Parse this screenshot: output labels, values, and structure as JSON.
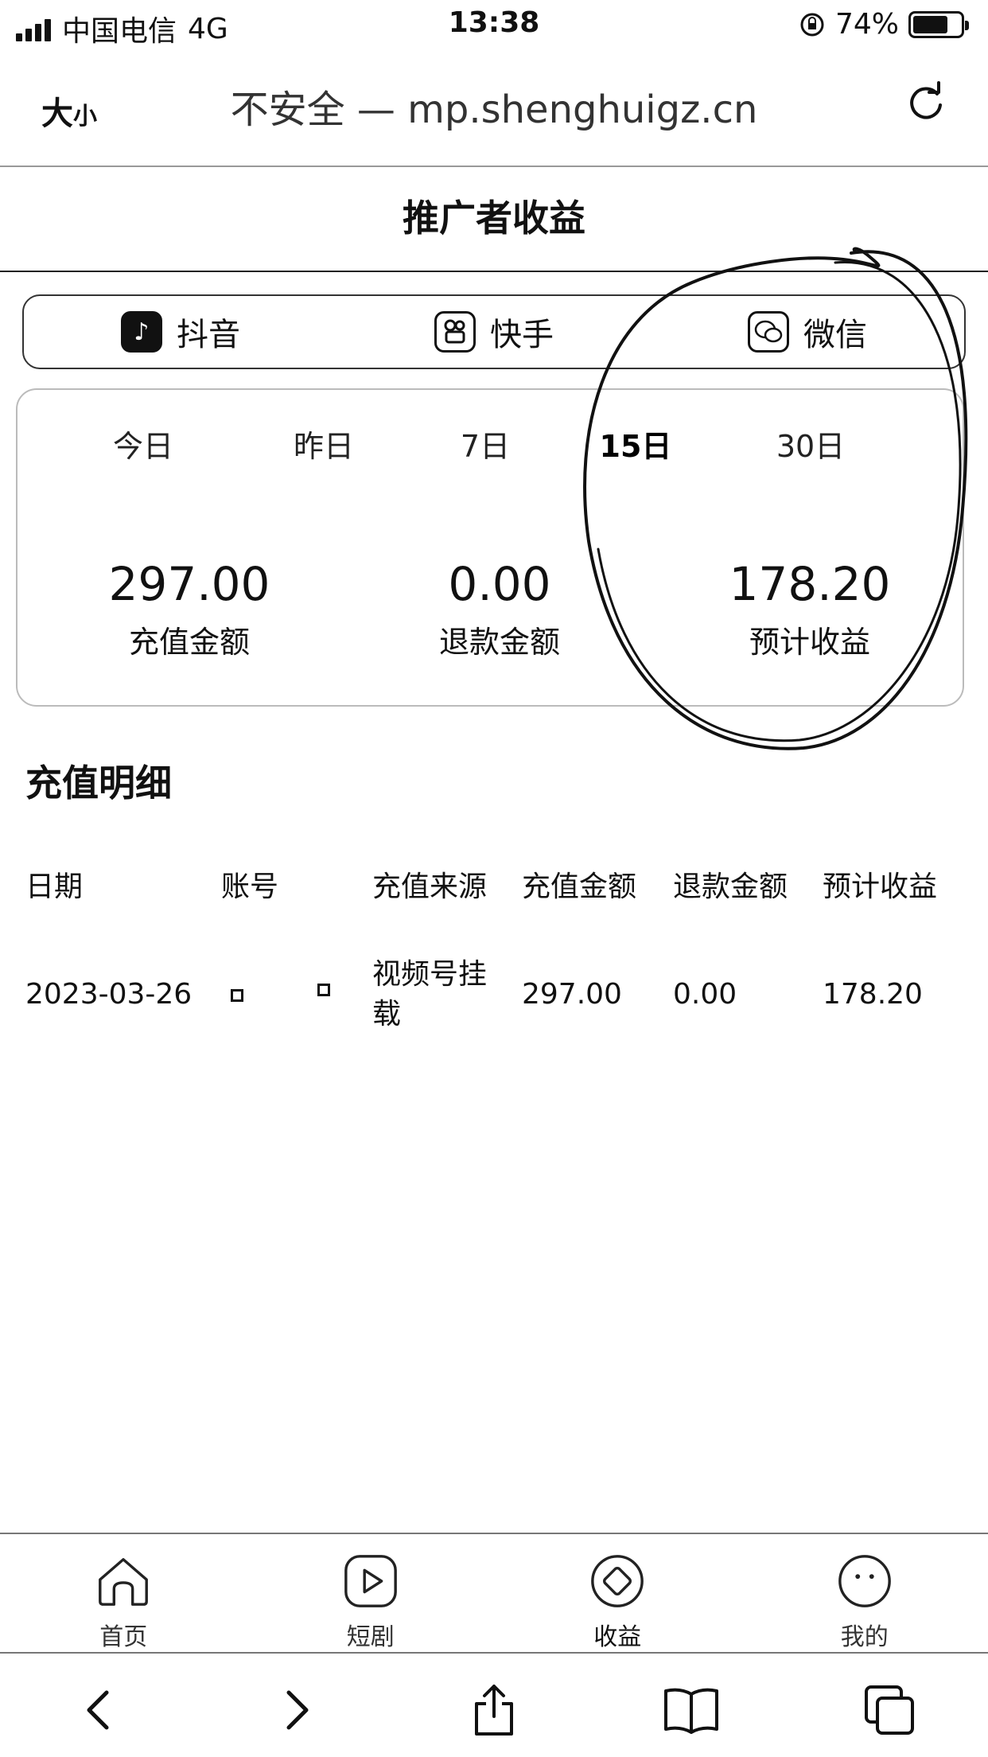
{
  "status_bar": {
    "carrier": "中国电信",
    "network": "4G",
    "time": "13:38",
    "battery": "74%",
    "battery_level": 0.74
  },
  "address_bar": {
    "text_size_big": "大",
    "text_size_small": "小",
    "url": "不安全 — mp.shenghuigz.cn"
  },
  "page": {
    "title": "推广者收益"
  },
  "platform_tabs": [
    {
      "label": "抖音",
      "icon": "douyin-icon"
    },
    {
      "label": "快手",
      "icon": "kuaishou-icon"
    },
    {
      "label": "微信",
      "icon": "wechat-icon"
    }
  ],
  "periods": [
    {
      "label": "今日",
      "active": false
    },
    {
      "label": "昨日",
      "active": false
    },
    {
      "label": "7日",
      "active": false
    },
    {
      "label": "15日",
      "active": true
    },
    {
      "label": "30日",
      "active": false
    }
  ],
  "stats": [
    {
      "value": "297.00",
      "label": "充值金额"
    },
    {
      "value": "0.00",
      "label": "退款金额"
    },
    {
      "value": "178.20",
      "label": "预计收益"
    }
  ],
  "detail": {
    "title": "充值明细",
    "columns": [
      "日期",
      "账号",
      "充值来源",
      "充值金额",
      "退款金额",
      "预计收益"
    ],
    "rows": [
      {
        "date": "2023-03-26",
        "source_line1": "视频号挂",
        "source_line2": "载",
        "recharge": "297.00",
        "refund": "0.00",
        "income": "178.20"
      }
    ]
  },
  "tab_bar": [
    {
      "label": "首页",
      "icon": "home-icon"
    },
    {
      "label": "短剧",
      "icon": "play-icon"
    },
    {
      "label": "收益",
      "icon": "income-icon"
    },
    {
      "label": "我的",
      "icon": "profile-icon"
    }
  ],
  "browser_toolbar": [
    {
      "icon": "back-icon"
    },
    {
      "icon": "forward-icon"
    },
    {
      "icon": "share-icon"
    },
    {
      "icon": "bookmarks-icon"
    },
    {
      "icon": "tabs-icon"
    }
  ]
}
